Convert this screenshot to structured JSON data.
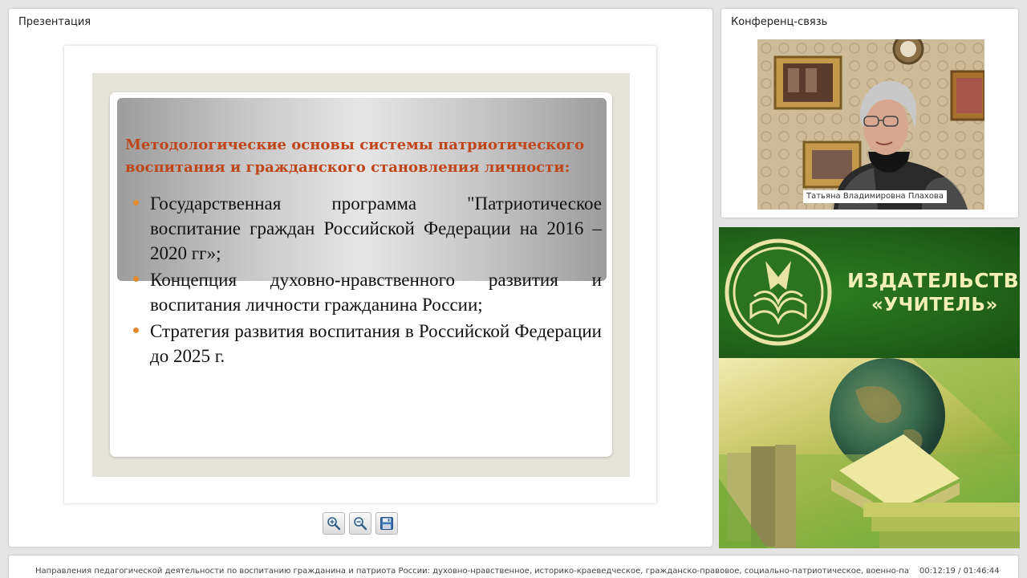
{
  "presentation_panel": {
    "title": "Презентация"
  },
  "slide": {
    "heading": "Методологические основы системы патриотического воспитания и гражданского становления личности:",
    "bullets": [
      "Государственная программа \"Патриотическое воспитание граждан Российской Федерации на 2016 – 2020 гг»;",
      "Концепция духовно-нравственного развития и воспитания личности гражданина России;",
      "Стратегия развития воспитания в Российской Федерации до 2025 г."
    ],
    "heading_color": "#c0461a",
    "bullet_color": "#e38a2c"
  },
  "toolbar": {
    "buttons": [
      {
        "name": "zoom-in",
        "icon": "zoom-in-icon"
      },
      {
        "name": "zoom-out",
        "icon": "zoom-out-icon"
      },
      {
        "name": "save",
        "icon": "save-icon"
      }
    ]
  },
  "conference_panel": {
    "title": "Конференц-связь",
    "participant_name": "Татьяна Владимировна Плахова"
  },
  "banner": {
    "line1": "ИЗДАТЕЛЬСТВО",
    "line2": "«УЧИТЕЛЬ»",
    "accent_color": "#f3f0b5",
    "background_color": "#1f5e18"
  },
  "footer": {
    "ticker_text": "Направления педагогической деятельности по воспитанию гражданина и патриота России: духовно-нравственное, историко-краеведческое, гражданско-правовое, социально-патриотическое, военно-патриотическое, культур",
    "timecode": "00:12:19 / 01:46:44"
  }
}
